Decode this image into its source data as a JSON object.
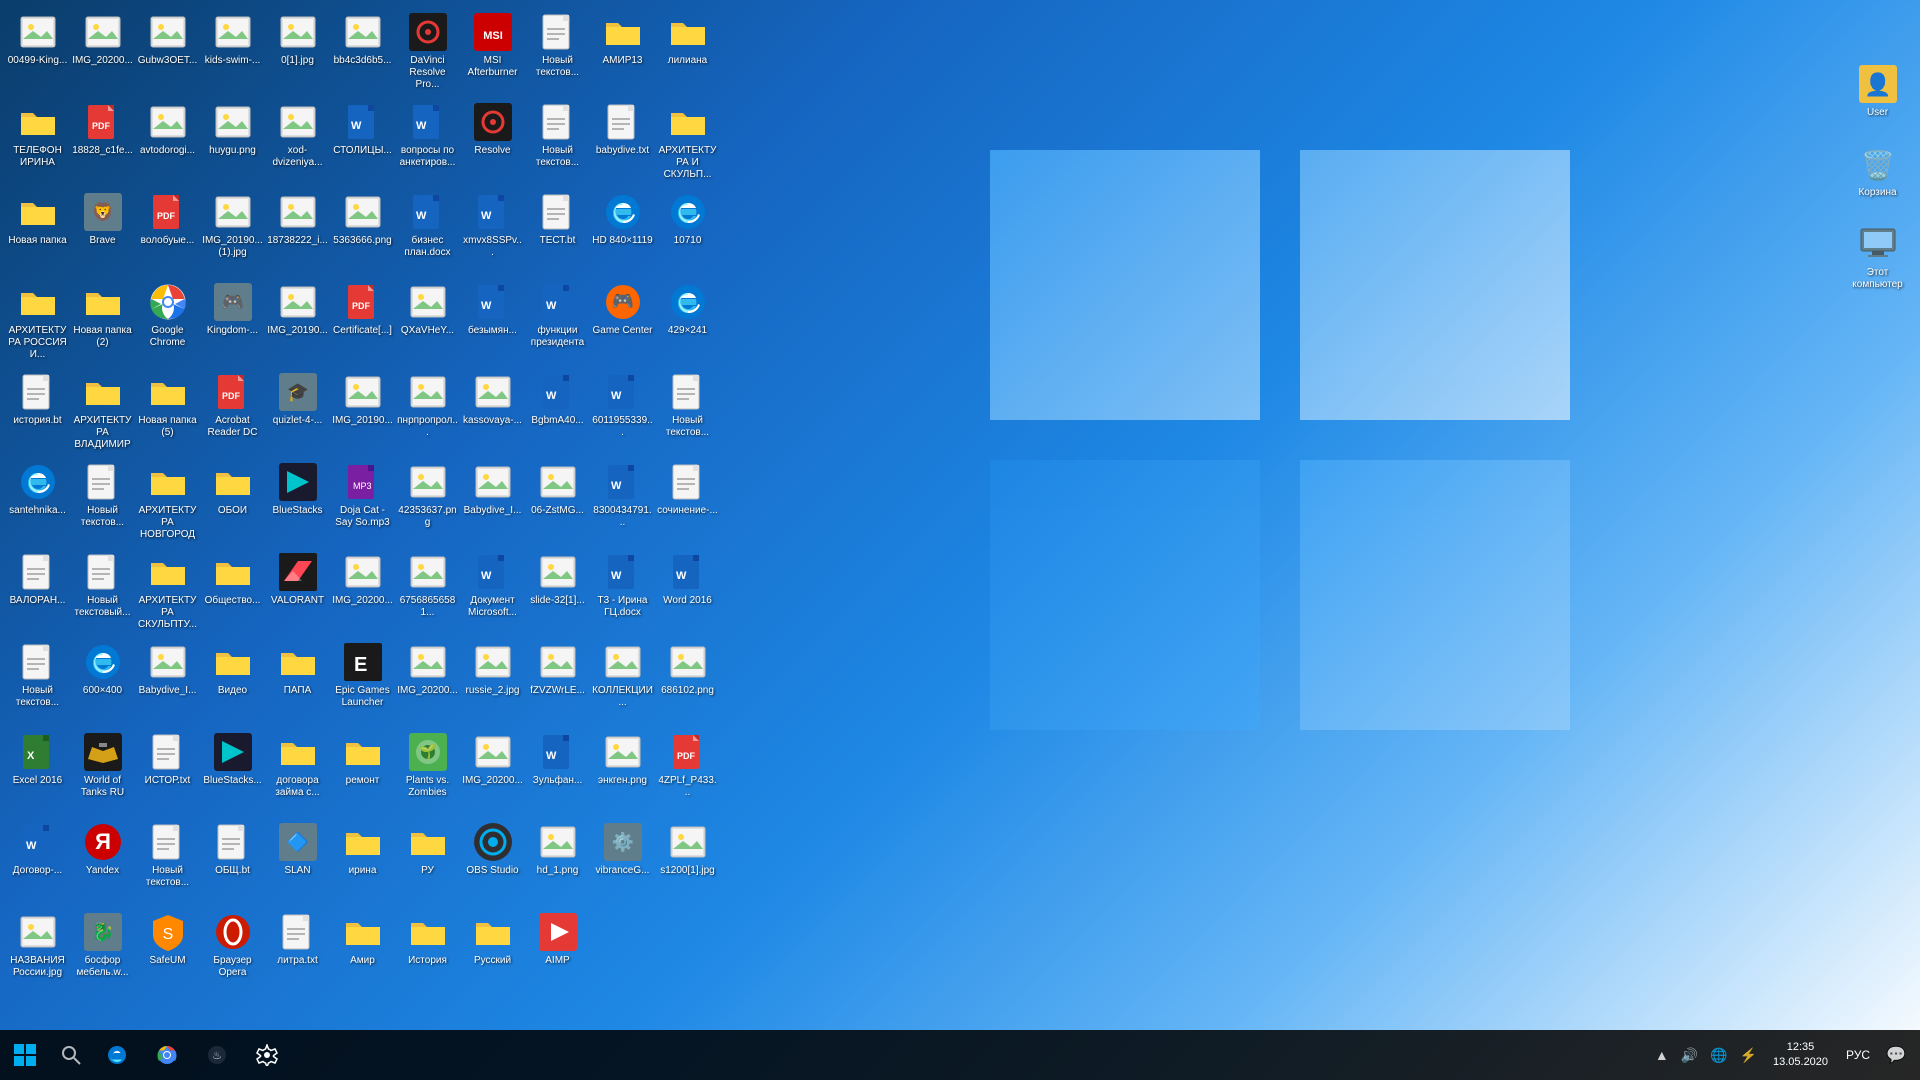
{
  "desktop": {
    "icons": [
      {
        "id": "00499",
        "label": "00499-King...",
        "type": "image",
        "emoji": "🖼️"
      },
      {
        "id": "IMG_20200",
        "label": "IMG_20200...",
        "type": "image",
        "emoji": "🖼️"
      },
      {
        "id": "Gubw3OET",
        "label": "Gubw3OET...",
        "type": "image",
        "emoji": "🖼️"
      },
      {
        "id": "kids-swim",
        "label": "kids-swim-...",
        "type": "image",
        "emoji": "🖼️"
      },
      {
        "id": "0[1]",
        "label": "0[1].jpg",
        "type": "image",
        "emoji": "🖼️"
      },
      {
        "id": "bb4c3d6b5",
        "label": "bb4c3d6b5...",
        "type": "image",
        "emoji": "🖼️"
      },
      {
        "id": "DaVinci",
        "label": "DaVinci Resolve Pro...",
        "type": "app",
        "emoji": "🎬"
      },
      {
        "id": "MSI",
        "label": "MSI Afterburner",
        "type": "app",
        "emoji": "🔥"
      },
      {
        "id": "NovTxt1",
        "label": "Новый текстов...",
        "type": "txt",
        "emoji": "📄"
      },
      {
        "id": "AMIR13",
        "label": "АМИР13",
        "type": "folder",
        "emoji": "📁"
      },
      {
        "id": "liliana",
        "label": "лилиана",
        "type": "folder",
        "emoji": "📁"
      },
      {
        "id": "telefon",
        "label": "ТЕЛЕФОН ИРИНА",
        "type": "folder",
        "emoji": "📁"
      },
      {
        "id": "18828",
        "label": "18828_c1fe...",
        "type": "pdf",
        "emoji": "📕"
      },
      {
        "id": "avtodorogi",
        "label": "avtodorogi...",
        "type": "image",
        "emoji": "🖼️"
      },
      {
        "id": "huygu",
        "label": "huygu.png",
        "type": "image",
        "emoji": "🖼️"
      },
      {
        "id": "xod-dvizeniya",
        "label": "xod-dvizeniya...",
        "type": "image",
        "emoji": "🖼️"
      },
      {
        "id": "stolicyi",
        "label": "СТОЛИЦЫ...",
        "type": "word",
        "emoji": "📘"
      },
      {
        "id": "voprosy",
        "label": "вопросы по анкетиров...",
        "type": "word",
        "emoji": "📘"
      },
      {
        "id": "Resolve",
        "label": "Resolve",
        "type": "app",
        "emoji": "🎬"
      },
      {
        "id": "NovTxt2",
        "label": "Новый текстов...",
        "type": "txt",
        "emoji": "📄"
      },
      {
        "id": "babydive",
        "label": "babydive.txt",
        "type": "txt",
        "emoji": "📄"
      },
      {
        "id": "ARH_SKULPT",
        "label": "АРХИТЕКТУРА И СКУЛЬП...",
        "type": "folder",
        "emoji": "📁"
      },
      {
        "id": "NovPapka",
        "label": "Новая папка",
        "type": "folder",
        "emoji": "📁"
      },
      {
        "id": "Brave",
        "label": "Brave",
        "type": "app",
        "emoji": "🦁"
      },
      {
        "id": "voloboye",
        "label": "волобуые...",
        "type": "pdf",
        "emoji": "📕"
      },
      {
        "id": "IMG_20190_1",
        "label": "IMG_20190... (1).jpg",
        "type": "image",
        "emoji": "🖼️"
      },
      {
        "id": "18738222",
        "label": "18738222_i...",
        "type": "image",
        "emoji": "🖼️"
      },
      {
        "id": "5363666",
        "label": "5363666.png",
        "type": "image",
        "emoji": "🖼️"
      },
      {
        "id": "biznesplan",
        "label": "бизнес план.docx",
        "type": "word",
        "emoji": "📘"
      },
      {
        "id": "xmvx8SSP",
        "label": "xmvx8SSPv...",
        "type": "word",
        "emoji": "📘"
      },
      {
        "id": "TEST",
        "label": "ТЕСТ.bt",
        "type": "txt",
        "emoji": "📄"
      },
      {
        "id": "HD840",
        "label": "HD 840×1119",
        "type": "edge",
        "emoji": "🌐"
      },
      {
        "id": "10710",
        "label": "10710",
        "type": "edge",
        "emoji": "🌐"
      },
      {
        "id": "ARH_RUSSIA",
        "label": "АРХИТЕКТУРА РОССИЯ И...",
        "type": "folder",
        "emoji": "📁"
      },
      {
        "id": "NovPapka2",
        "label": "Новая папка (2)",
        "type": "folder",
        "emoji": "📁"
      },
      {
        "id": "GoogleChrome",
        "label": "Google Chrome",
        "type": "chrome",
        "emoji": "🌐"
      },
      {
        "id": "Kingdom",
        "label": "Kingdom-...",
        "type": "app",
        "emoji": "🎮"
      },
      {
        "id": "IMG_20190_2",
        "label": "IMG_20190...",
        "type": "image",
        "emoji": "🖼️"
      },
      {
        "id": "Certificate",
        "label": "Certificate[...]",
        "type": "pdf",
        "emoji": "📕"
      },
      {
        "id": "QXaVHeY",
        "label": "QXaVHeY...",
        "type": "image",
        "emoji": "🖼️"
      },
      {
        "id": "bezymyan",
        "label": "безымян...",
        "type": "word",
        "emoji": "📘"
      },
      {
        "id": "funprezident",
        "label": "функции президента",
        "type": "word",
        "emoji": "📘"
      },
      {
        "id": "GameCenter",
        "label": "Game Center",
        "type": "app",
        "emoji": "🎮"
      },
      {
        "id": "429x241",
        "label": "429×241",
        "type": "edge",
        "emoji": "🌐"
      },
      {
        "id": "istoriya",
        "label": "история.bt",
        "type": "txt",
        "emoji": "📄"
      },
      {
        "id": "ARH_VLAD",
        "label": "АРХИТЕКТУРА ВЛАДИМИР",
        "type": "folder",
        "emoji": "📁"
      },
      {
        "id": "NovPapka5",
        "label": "Новая папка (5)",
        "type": "folder",
        "emoji": "📁"
      },
      {
        "id": "AcrobatDC",
        "label": "Acrobat Reader DC",
        "type": "pdf",
        "emoji": "📕"
      },
      {
        "id": "quizlet4",
        "label": "quizlet-4-...",
        "type": "app",
        "emoji": "🎓"
      },
      {
        "id": "IMG_20190_3",
        "label": "IMG_20190...",
        "type": "image",
        "emoji": "🖼️"
      },
      {
        "id": "pnrproprol",
        "label": "пнрпропрол...",
        "type": "image",
        "emoji": "🖼️"
      },
      {
        "id": "kassovaya",
        "label": "kassovaya-...",
        "type": "image",
        "emoji": "🖼️"
      },
      {
        "id": "BgbmA40",
        "label": "BgbmA40...",
        "type": "word",
        "emoji": "📘"
      },
      {
        "id": "6011955339",
        "label": "6011955339...",
        "type": "word",
        "emoji": "📘"
      },
      {
        "id": "NovTxt3",
        "label": "Новый текстов...",
        "type": "txt",
        "emoji": "📄"
      },
      {
        "id": "santehnika",
        "label": "santehnika...",
        "type": "edge",
        "emoji": "🌐"
      },
      {
        "id": "NovTxt4",
        "label": "Новый текстов...",
        "type": "txt",
        "emoji": "📄"
      },
      {
        "id": "ARH_NOVG",
        "label": "АРХИТЕКТУРА НОВГОРОД",
        "type": "folder",
        "emoji": "📁"
      },
      {
        "id": "OBOI",
        "label": "ОБОИ",
        "type": "folder",
        "emoji": "📁"
      },
      {
        "id": "BlueStacks",
        "label": "BlueStacks",
        "type": "app",
        "emoji": "📱"
      },
      {
        "id": "DojaCat",
        "label": "Doja Cat - Say So.mp3",
        "type": "audio",
        "emoji": "🎵"
      },
      {
        "id": "42353637",
        "label": "42353637.png",
        "type": "image",
        "emoji": "🖼️"
      },
      {
        "id": "Babydive_I",
        "label": "Babydive_I...",
        "type": "image",
        "emoji": "🖼️"
      },
      {
        "id": "06-ZstMG",
        "label": "06-ZstMG...",
        "type": "image",
        "emoji": "🖼️"
      },
      {
        "id": "8300434791",
        "label": "8300434791...",
        "type": "word",
        "emoji": "📘"
      },
      {
        "id": "sochinenie",
        "label": "сочинение-...",
        "type": "txt",
        "emoji": "📄"
      },
      {
        "id": "VALORANT2",
        "label": "ВАЛОРАН...",
        "type": "txt",
        "emoji": "📄"
      },
      {
        "id": "NovTxt5",
        "label": "Новый текстовый...",
        "type": "txt",
        "emoji": "📄"
      },
      {
        "id": "ARH_SKULPT2",
        "label": "АРХИТЕКТУРА СКУЛЬПТУ...",
        "type": "folder",
        "emoji": "📁"
      },
      {
        "id": "Obshestvo",
        "label": "Общество...",
        "type": "folder",
        "emoji": "📁"
      },
      {
        "id": "VALORANT_app",
        "label": "VALORANT",
        "type": "valorant",
        "emoji": "🔫"
      },
      {
        "id": "IMG_20200_2",
        "label": "IMG_20200...",
        "type": "image",
        "emoji": "🖼️"
      },
      {
        "id": "67568656581",
        "label": "67568656581...",
        "type": "image",
        "emoji": "🖼️"
      },
      {
        "id": "Dokument_MS",
        "label": "Документ Microsoft...",
        "type": "word",
        "emoji": "📘"
      },
      {
        "id": "slide-32",
        "label": "slide-32[1]...",
        "type": "image",
        "emoji": "🖼️"
      },
      {
        "id": "T3-Irina",
        "label": "Т3 - Ирина ГЦ.docx",
        "type": "word",
        "emoji": "📘"
      },
      {
        "id": "Word2016",
        "label": "Word 2016",
        "type": "word_app",
        "emoji": "📘"
      },
      {
        "id": "NovTxt6",
        "label": "Новый текстов...",
        "type": "txt",
        "emoji": "📄"
      },
      {
        "id": "600x400",
        "label": "600×400",
        "type": "edge",
        "emoji": "🌐"
      },
      {
        "id": "Babydive_I2",
        "label": "Babydive_I...",
        "type": "image",
        "emoji": "🖼️"
      },
      {
        "id": "Video",
        "label": "Видео",
        "type": "folder",
        "emoji": "📁"
      },
      {
        "id": "PAPA",
        "label": "ПАПА",
        "type": "folder",
        "emoji": "📁"
      },
      {
        "id": "EpicGames",
        "label": "Epic Games Launcher",
        "type": "app",
        "emoji": "🎮"
      },
      {
        "id": "IMG_20200_3",
        "label": "IMG_20200...",
        "type": "image",
        "emoji": "🖼️"
      },
      {
        "id": "russie_2",
        "label": "russie_2.jpg",
        "type": "image",
        "emoji": "🖼️"
      },
      {
        "id": "fZVZWrLE",
        "label": "fZVZWrLE...",
        "type": "image",
        "emoji": "🖼️"
      },
      {
        "id": "KOLLEKCII",
        "label": "КОЛЛЕКЦИИ...",
        "type": "image",
        "emoji": "🖼️"
      },
      {
        "id": "686102",
        "label": "686102.png",
        "type": "image",
        "emoji": "🖼️"
      },
      {
        "id": "Excel2016",
        "label": "Excel 2016",
        "type": "excel_app",
        "emoji": "📗"
      },
      {
        "id": "WOT",
        "label": "World of Tanks RU",
        "type": "wot",
        "emoji": "🎮"
      },
      {
        "id": "ISTORT",
        "label": "ИСТОР.txt",
        "type": "txt",
        "emoji": "📄"
      },
      {
        "id": "BlueStacksI",
        "label": "BlueStacks...",
        "type": "app",
        "emoji": "📱"
      },
      {
        "id": "dogovor",
        "label": "договора займа с...",
        "type": "folder",
        "emoji": "📁"
      },
      {
        "id": "remont",
        "label": "ремонт",
        "type": "folder",
        "emoji": "📁"
      },
      {
        "id": "PvZ",
        "label": "Plants vs. Zombies",
        "type": "pvz",
        "emoji": "🌱"
      },
      {
        "id": "IMG_20200_4",
        "label": "IMG_20200...",
        "type": "image",
        "emoji": "🖼️"
      },
      {
        "id": "3ulfan",
        "label": "Зульфан...",
        "type": "word",
        "emoji": "📘"
      },
      {
        "id": "engken",
        "label": "энкген.png",
        "type": "image",
        "emoji": "🖼️"
      },
      {
        "id": "4ZPLf_P433",
        "label": "4ZPLf_P433...",
        "type": "pdf",
        "emoji": "📕"
      },
      {
        "id": "Dogovor",
        "label": "Договор-...",
        "type": "word",
        "emoji": "📘"
      },
      {
        "id": "Yandex",
        "label": "Yandex",
        "type": "yandex",
        "emoji": "🔴"
      },
      {
        "id": "NovTxt7",
        "label": "Новый текстов...",
        "type": "txt",
        "emoji": "📄"
      },
      {
        "id": "OBSH",
        "label": "ОБЩ.bt",
        "type": "txt",
        "emoji": "📄"
      },
      {
        "id": "SLAN",
        "label": "SLAN",
        "type": "app",
        "emoji": "🔷"
      },
      {
        "id": "irina",
        "label": "ирина",
        "type": "folder",
        "emoji": "📁"
      },
      {
        "id": "RU",
        "label": "РУ",
        "type": "folder",
        "emoji": "📁"
      },
      {
        "id": "OBS",
        "label": "OBS Studio",
        "type": "obs",
        "emoji": "🎥"
      },
      {
        "id": "hd_1",
        "label": "hd_1.png",
        "type": "image",
        "emoji": "🖼️"
      },
      {
        "id": "vibranceG",
        "label": "vibranceG...",
        "type": "app",
        "emoji": "⚙️"
      },
      {
        "id": "s1200_1",
        "label": "s1200[1].jpg",
        "type": "image",
        "emoji": "🖼️"
      },
      {
        "id": "nazRossii",
        "label": "НАЗВАНИЯ России.jpg",
        "type": "image",
        "emoji": "🖼️"
      },
      {
        "id": "bosfDragon",
        "label": "босфор мебель.w...",
        "type": "app",
        "emoji": "🐉"
      },
      {
        "id": "SafeUM",
        "label": "SafeUM",
        "type": "safeup",
        "emoji": "🛡️"
      },
      {
        "id": "Opera",
        "label": "Браузер Opera",
        "type": "opera",
        "emoji": "🔴"
      },
      {
        "id": "litra",
        "label": "литра.txt",
        "type": "txt",
        "emoji": "📄"
      },
      {
        "id": "Amir",
        "label": "Амир",
        "type": "folder",
        "emoji": "📁"
      },
      {
        "id": "Istoriya",
        "label": "История",
        "type": "folder",
        "emoji": "📁"
      },
      {
        "id": "Russkiy",
        "label": "Русский",
        "type": "folder",
        "emoji": "📁"
      },
      {
        "id": "AIMP",
        "label": "AIMP",
        "type": "aimp",
        "emoji": "🎵"
      }
    ]
  },
  "top_right_icons": [
    {
      "id": "user",
      "label": "User",
      "emoji": "👤"
    },
    {
      "id": "korzina",
      "label": "Корзина",
      "emoji": "🗑️"
    },
    {
      "id": "computer",
      "label": "Этот компьютер",
      "emoji": "💻"
    }
  ],
  "taskbar": {
    "start_label": "⊞",
    "search_label": "🔍",
    "task_view": "⧉",
    "buttons": [
      {
        "id": "edge",
        "emoji": "🌐",
        "label": "Edge"
      },
      {
        "id": "chrome",
        "emoji": "🌐",
        "label": "Chrome"
      },
      {
        "id": "steam",
        "emoji": "♨",
        "label": "Steam"
      },
      {
        "id": "settings",
        "emoji": "⚙",
        "label": "Settings"
      }
    ],
    "tray": {
      "icons": [
        "▲",
        "🔇",
        "🔋",
        "📡"
      ],
      "lang": "РУС",
      "time": "12:35",
      "date": "13.05.2020",
      "notification": "💬"
    }
  }
}
